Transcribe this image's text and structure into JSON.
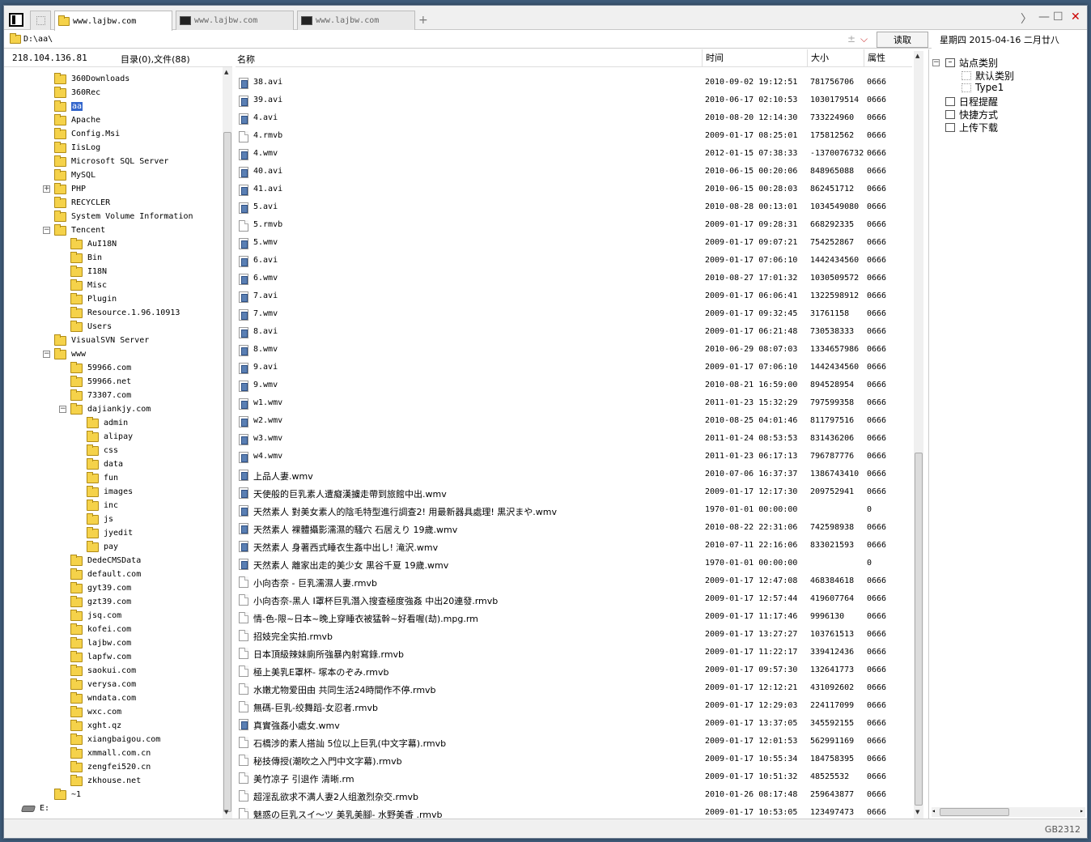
{
  "tabs": [
    {
      "label": "www.lajbw.com",
      "active": true,
      "icon": "folder-icon"
    },
    {
      "label": "www.lajbw.com",
      "active": false,
      "icon": "terminal-icon"
    },
    {
      "label": "www.lajbw.com",
      "active": false,
      "icon": "terminal-icon"
    }
  ],
  "add_tab": "+",
  "window_controls": {
    "nav": "〉",
    "minimize": "—",
    "maximize": "☐",
    "close": "✕"
  },
  "address": {
    "path": "D:\\aa\\",
    "plus": "±",
    "dropdown": "⌵",
    "read_button": "读取"
  },
  "date": "星期四 2015-04-16 二月廿八",
  "status_left": {
    "ip": "218.104.136.81",
    "summary": "目录(0),文件(88)"
  },
  "columns": {
    "name": "名称",
    "time": "时间",
    "size": "大小",
    "attr": "属性"
  },
  "tree": [
    {
      "label": "360Downloads",
      "depth": 1
    },
    {
      "label": "360Rec",
      "depth": 1
    },
    {
      "label": "aa",
      "depth": 1,
      "selected": true
    },
    {
      "label": "Apache",
      "depth": 1
    },
    {
      "label": "Config.Msi",
      "depth": 1
    },
    {
      "label": "IisLog",
      "depth": 1
    },
    {
      "label": "Microsoft SQL Server",
      "depth": 1
    },
    {
      "label": "MySQL",
      "depth": 1
    },
    {
      "label": "PHP",
      "depth": 1,
      "expander": "+"
    },
    {
      "label": "RECYCLER",
      "depth": 1
    },
    {
      "label": "System Volume Information",
      "depth": 1
    },
    {
      "label": "Tencent",
      "depth": 1,
      "expander": "−"
    },
    {
      "label": "AuI18N",
      "depth": 2
    },
    {
      "label": "Bin",
      "depth": 2
    },
    {
      "label": "I18N",
      "depth": 2
    },
    {
      "label": "Misc",
      "depth": 2
    },
    {
      "label": "Plugin",
      "depth": 2
    },
    {
      "label": "Resource.1.96.10913",
      "depth": 2
    },
    {
      "label": "Users",
      "depth": 2
    },
    {
      "label": "VisualSVN Server",
      "depth": 1
    },
    {
      "label": "www",
      "depth": 1,
      "expander": "−"
    },
    {
      "label": "59966.com",
      "depth": 2
    },
    {
      "label": "59966.net",
      "depth": 2
    },
    {
      "label": "73307.com",
      "depth": 2
    },
    {
      "label": "dajiankjy.com",
      "depth": 2,
      "expander": "−"
    },
    {
      "label": "admin",
      "depth": 3
    },
    {
      "label": "alipay",
      "depth": 3
    },
    {
      "label": "css",
      "depth": 3
    },
    {
      "label": "data",
      "depth": 3
    },
    {
      "label": "fun",
      "depth": 3
    },
    {
      "label": "images",
      "depth": 3
    },
    {
      "label": "inc",
      "depth": 3
    },
    {
      "label": "js",
      "depth": 3
    },
    {
      "label": "jyedit",
      "depth": 3
    },
    {
      "label": "pay",
      "depth": 3
    },
    {
      "label": "DedeCMSData",
      "depth": 2
    },
    {
      "label": "default.com",
      "depth": 2
    },
    {
      "label": "gyt39.com",
      "depth": 2
    },
    {
      "label": "gzt39.com",
      "depth": 2
    },
    {
      "label": "jsq.com",
      "depth": 2
    },
    {
      "label": "kofei.com",
      "depth": 2
    },
    {
      "label": "lajbw.com",
      "depth": 2
    },
    {
      "label": "lapfw.com",
      "depth": 2
    },
    {
      "label": "saokui.com",
      "depth": 2
    },
    {
      "label": "verysa.com",
      "depth": 2
    },
    {
      "label": "wndata.com",
      "depth": 2
    },
    {
      "label": "wxc.com",
      "depth": 2
    },
    {
      "label": "xght.qz",
      "depth": 2
    },
    {
      "label": "xiangbaigou.com",
      "depth": 2
    },
    {
      "label": "xmmall.com.cn",
      "depth": 2
    },
    {
      "label": "zengfei520.cn",
      "depth": 2
    },
    {
      "label": "zkhouse.net",
      "depth": 2
    },
    {
      "label": "~1",
      "depth": 1
    },
    {
      "label": "E:",
      "depth": 0,
      "drive": true
    }
  ],
  "files": [
    {
      "name": "38.avi",
      "time": "2010-09-02 19:12:51",
      "size": "781756706",
      "attr": "0666",
      "icon": "video"
    },
    {
      "name": "39.avi",
      "time": "2010-06-17 02:10:53",
      "size": "1030179514",
      "attr": "0666",
      "icon": "video"
    },
    {
      "name": "4.avi",
      "time": "2010-08-20 12:14:30",
      "size": "733224960",
      "attr": "0666",
      "icon": "video"
    },
    {
      "name": "4.rmvb",
      "time": "2009-01-17 08:25:01",
      "size": "175812562",
      "attr": "0666",
      "icon": "doc"
    },
    {
      "name": "4.wmv",
      "time": "2012-01-15 07:38:33",
      "size": "-1370076732",
      "attr": "0666",
      "icon": "video"
    },
    {
      "name": "40.avi",
      "time": "2010-06-15 00:20:06",
      "size": "848965088",
      "attr": "0666",
      "icon": "video"
    },
    {
      "name": "41.avi",
      "time": "2010-06-15 00:28:03",
      "size": "862451712",
      "attr": "0666",
      "icon": "video"
    },
    {
      "name": "5.avi",
      "time": "2010-08-28 00:13:01",
      "size": "1034549080",
      "attr": "0666",
      "icon": "video"
    },
    {
      "name": "5.rmvb",
      "time": "2009-01-17 09:28:31",
      "size": "668292335",
      "attr": "0666",
      "icon": "doc"
    },
    {
      "name": "5.wmv",
      "time": "2009-01-17 09:07:21",
      "size": "754252867",
      "attr": "0666",
      "icon": "video"
    },
    {
      "name": "6.avi",
      "time": "2009-01-17 07:06:10",
      "size": "1442434560",
      "attr": "0666",
      "icon": "video"
    },
    {
      "name": "6.wmv",
      "time": "2010-08-27 17:01:32",
      "size": "1030509572",
      "attr": "0666",
      "icon": "video"
    },
    {
      "name": "7.avi",
      "time": "2009-01-17 06:06:41",
      "size": "1322598912",
      "attr": "0666",
      "icon": "video"
    },
    {
      "name": "7.wmv",
      "time": "2009-01-17 09:32:45",
      "size": "31761158",
      "attr": "0666",
      "icon": "video"
    },
    {
      "name": "8.avi",
      "time": "2009-01-17 06:21:48",
      "size": "730538333",
      "attr": "0666",
      "icon": "video"
    },
    {
      "name": "8.wmv",
      "time": "2010-06-29 08:07:03",
      "size": "1334657986",
      "attr": "0666",
      "icon": "video"
    },
    {
      "name": "9.avi",
      "time": "2009-01-17 07:06:10",
      "size": "1442434560",
      "attr": "0666",
      "icon": "video"
    },
    {
      "name": "9.wmv",
      "time": "2010-08-21 16:59:00",
      "size": "894528954",
      "attr": "0666",
      "icon": "video"
    },
    {
      "name": "w1.wmv",
      "time": "2011-01-23 15:32:29",
      "size": "797599358",
      "attr": "0666",
      "icon": "video"
    },
    {
      "name": "w2.wmv",
      "time": "2010-08-25 04:01:46",
      "size": "811797516",
      "attr": "0666",
      "icon": "video"
    },
    {
      "name": "w3.wmv",
      "time": "2011-01-24 08:53:53",
      "size": "831436206",
      "attr": "0666",
      "icon": "video"
    },
    {
      "name": "w4.wmv",
      "time": "2011-01-23 06:17:13",
      "size": "796787776",
      "attr": "0666",
      "icon": "video"
    },
    {
      "name": "上品人妻.wmv",
      "time": "2010-07-06 16:37:37",
      "size": "1386743410",
      "attr": "0666",
      "icon": "video"
    },
    {
      "name": "天使般的巨乳素人遭癡漢擄走帶到旅館中出.wmv",
      "time": "2009-01-17 12:17:30",
      "size": "209752941",
      "attr": "0666",
      "icon": "video"
    },
    {
      "name": "天然素人 對美女素人的陰毛特型進行調查2! 用最新器具處理! 黒沢まや.wmv",
      "time": "1970-01-01 00:00:00",
      "size": "",
      "attr": "0",
      "icon": "video"
    },
    {
      "name": "天然素人 裸體攝影濡濕的騷穴 石居えり 19歲.wmv",
      "time": "2010-08-22 22:31:06",
      "size": "742598938",
      "attr": "0666",
      "icon": "video"
    },
    {
      "name": "天然素人 身著西式睡衣生姦中出し! 滝沢.wmv",
      "time": "2010-07-11 22:16:06",
      "size": "833021593",
      "attr": "0666",
      "icon": "video"
    },
    {
      "name": "天然素人 離家出走的美少女 黒谷千夏 19歲.wmv",
      "time": "1970-01-01 00:00:00",
      "size": "",
      "attr": "0",
      "icon": "video"
    },
    {
      "name": "小向杏奈 - 巨乳濡濕人妻.rmvb",
      "time": "2009-01-17 12:47:08",
      "size": "468384618",
      "attr": "0666",
      "icon": "doc"
    },
    {
      "name": "小向杏奈-黑人 I罩杯巨乳潛入搜查極度強姦 中出20連發.rmvb",
      "time": "2009-01-17 12:57:44",
      "size": "419607764",
      "attr": "0666",
      "icon": "doc"
    },
    {
      "name": "情-色-限~日本~晚上穿睡衣被猛幹~好看喔(劫).mpg.rm",
      "time": "2009-01-17 11:17:46",
      "size": "9996130",
      "attr": "0666",
      "icon": "doc"
    },
    {
      "name": "招妓完全实拍.rmvb",
      "time": "2009-01-17 13:27:27",
      "size": "103761513",
      "attr": "0666",
      "icon": "doc"
    },
    {
      "name": "日本頂級辣妹廁所強暴內射寫錄.rmvb",
      "time": "2009-01-17 11:22:17",
      "size": "339412436",
      "attr": "0666",
      "icon": "doc"
    },
    {
      "name": "極上美乳E罩杯- 塚本のぞみ.rmvb",
      "time": "2009-01-17 09:57:30",
      "size": "132641773",
      "attr": "0666",
      "icon": "doc"
    },
    {
      "name": "水嫩尤物爱田由 共同生活24時間作不停.rmvb",
      "time": "2009-01-17 12:12:21",
      "size": "431092602",
      "attr": "0666",
      "icon": "doc"
    },
    {
      "name": "無碼-巨乳-绞舞蹈-女忍者.rmvb",
      "time": "2009-01-17 12:29:03",
      "size": "224117099",
      "attr": "0666",
      "icon": "doc"
    },
    {
      "name": "真實強姦小處女.wmv",
      "time": "2009-01-17 13:37:05",
      "size": "345592155",
      "attr": "0666",
      "icon": "video"
    },
    {
      "name": "石橋涉的素人搭訕 5位以上巨乳(中文字幕).rmvb",
      "time": "2009-01-17 12:01:53",
      "size": "562991169",
      "attr": "0666",
      "icon": "doc"
    },
    {
      "name": "秘技傳授(潮吹之入門中文字幕).rmvb",
      "time": "2009-01-17 10:55:34",
      "size": "184758395",
      "attr": "0666",
      "icon": "doc"
    },
    {
      "name": "美竹凉子 引退作 清晰.rm",
      "time": "2009-01-17 10:51:32",
      "size": "48525532",
      "attr": "0666",
      "icon": "doc"
    },
    {
      "name": "超淫乱欲求不满人妻2人组激烈杂交.rmvb",
      "time": "2010-01-26 08:17:48",
      "size": "259643877",
      "attr": "0666",
      "icon": "doc"
    },
    {
      "name": "魅惑の巨乳スイ〜ツ 美乳美腳- 水野美香 .rmvb",
      "time": "2009-01-17 10:53:05",
      "size": "123497473",
      "attr": "0666",
      "icon": "doc"
    }
  ],
  "right_tree": [
    {
      "label": "站点类别",
      "depth": 0,
      "expander": "−",
      "icon": "category-box-icon"
    },
    {
      "label": "默认类别",
      "depth": 1,
      "icon": "dotted-box-icon"
    },
    {
      "label": "Type1",
      "depth": 1,
      "icon": "dotted-box-icon"
    },
    {
      "label": "日程提醒",
      "depth": 0,
      "icon": "schedule-icon"
    },
    {
      "label": "快捷方式",
      "depth": 0,
      "icon": "shortcut-icon"
    },
    {
      "label": "上传下载",
      "depth": 0,
      "icon": "transfer-icon"
    }
  ],
  "encoding": "GB2312"
}
